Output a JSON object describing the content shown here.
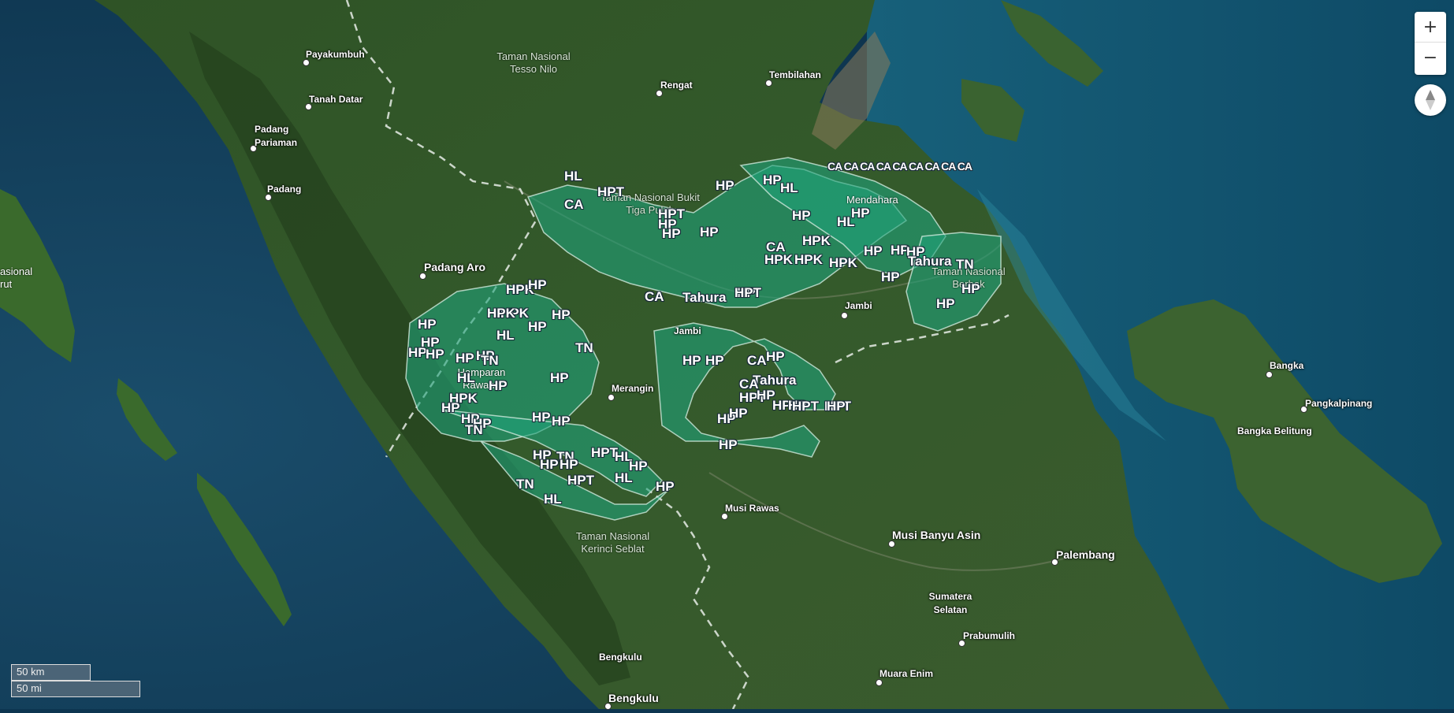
{
  "map": {
    "cities": [
      {
        "name": "Payakumbuh"
      },
      {
        "name": "Tanah Datar"
      },
      {
        "name": "Padang Pariaman"
      },
      {
        "name": "Padang"
      },
      {
        "name": "Padang Aro"
      },
      {
        "name": "Rengat"
      },
      {
        "name": "Tembilahan"
      },
      {
        "name": "Jambi"
      },
      {
        "name": "Merangin"
      },
      {
        "name": "Musi Rawas"
      },
      {
        "name": "Musi Banyu Asin"
      },
      {
        "name": "Palembang"
      },
      {
        "name": "Prabumulih"
      },
      {
        "name": "Muara Enim"
      },
      {
        "name": "Bengkulu"
      },
      {
        "name": "Bangka"
      },
      {
        "name": "Pangkalpinang"
      }
    ],
    "regions": {
      "bengkulu_region": "Bengkulu",
      "jambi_region": "Jambi",
      "bangka_belitung": "Bangka Belitung",
      "sumatera_selatan": "Sumatera Selatan",
      "mendahara": "Mendahara",
      "hamparan_rawang": "Hamparan Rawang",
      "left_edge": "asional rut"
    },
    "parks": {
      "tesso_nilo": "Taman Nasional Tesso Nilo",
      "bukit_tiga_puluh": "Taman Nasional Bukit Tiga Puluh",
      "berbak": "Taman Nasional Berbak",
      "kerinci_seblat": "Taman Nasional Kerinci Seblat"
    },
    "zone_codes": [
      "HL",
      "CA",
      "HPT",
      "HP",
      "HPK",
      "TN",
      "Tahura"
    ],
    "zone_labels": [
      "HL",
      "HPT",
      "CA",
      "HP",
      "HP",
      "HL",
      "HPT",
      "HP",
      "HP",
      "HP",
      "HL",
      "CA",
      "HP",
      "HP",
      "HPK",
      "HPK",
      "HP",
      "HPK",
      "HPK",
      "HP",
      "HP",
      "HP",
      "HP",
      "Tahura",
      "TN",
      "HP",
      "HP",
      "HPK",
      "HP",
      "CA",
      "Tahura",
      "HPT",
      "HPK",
      "HPK",
      "HP",
      "HL",
      "HP",
      "HP",
      "HP",
      "HP",
      "HP",
      "HP",
      "HP",
      "TN",
      "HL",
      "TN",
      "HP",
      "HP",
      "HPK",
      "HP",
      "HP",
      "HP",
      "TN",
      "HP",
      "HP",
      "CA",
      "Tahura",
      "HP",
      "CA",
      "HPT",
      "HP",
      "HPT",
      "HP",
      "HP",
      "HP",
      "HP",
      "HPT",
      "HPT",
      "HP",
      "HP",
      "HP",
      "TN",
      "HP",
      "HP",
      "HP",
      "HPT",
      "HL",
      "HP",
      "TN",
      "HPT",
      "HL",
      "HL",
      "HP"
    ],
    "ca_coast_string": "CA CA CA CA CA CA CA CA CA"
  },
  "controls": {
    "zoom_in": "+",
    "zoom_out": "−",
    "compass_icon": "compass-icon"
  },
  "scale": {
    "km": "50 km",
    "mi": "50 mi"
  },
  "colors": {
    "sea": "#0d3550",
    "land": "#2e4e26",
    "forest_overlay": "#1fa27a",
    "boundary_dash": "#e6ece6"
  }
}
